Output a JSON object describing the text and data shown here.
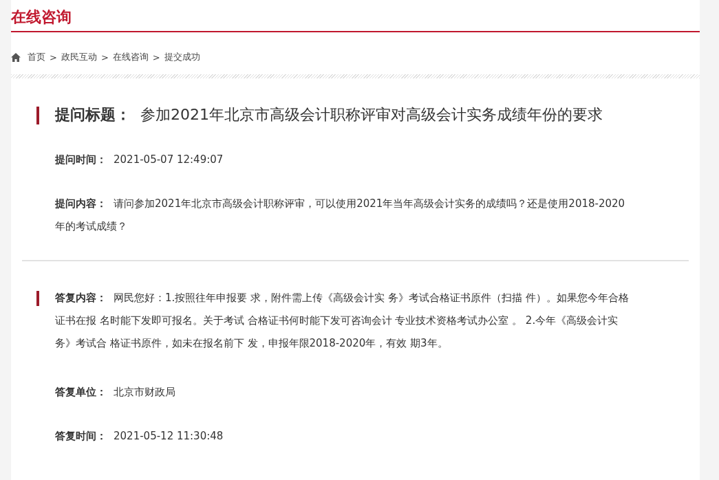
{
  "header": {
    "title": "在线咨询"
  },
  "breadcrumb": [
    "首页",
    "政民互动",
    "在线咨询",
    "提交成功"
  ],
  "breadcrumb_separator": ">",
  "question": {
    "title_label": "提问标题：",
    "title": "参加2021年北京市高级会计职称评审对高级会计实务成绩年份的要求",
    "fields": [
      {
        "label": "提问时间：",
        "value": "2021-05-07 12:49:07"
      },
      {
        "label": "提问内容：",
        "value": "请问参加2021年北京市高级会计职称评审，可以使用2021年当年高级会计实务的成绩吗？还是使用2018-2020年的考试成绩？"
      }
    ]
  },
  "answer": {
    "fields": [
      {
        "kind": "accent",
        "label": "答复内容：",
        "value": "网民您好：1.按照往年申报要 求，附件需上传《高级会计实 务》考试合格证书原件（扫描 件）。如果您今年合格证书在报 名时能下发即可报名。关于考试 合格证书何时能下发可咨询会计 专业技术资格考试办公室 。 2.今年《高级会计实务》考试合 格证书原件，如未在报名前下 发，申报年限2018-2020年，有效 期3年。"
      },
      {
        "kind": "plain",
        "label": "答复单位：",
        "value": "北京市财政局"
      },
      {
        "kind": "plain",
        "label": "答复时间：",
        "value": "2021-05-12 11:30:48"
      }
    ]
  }
}
